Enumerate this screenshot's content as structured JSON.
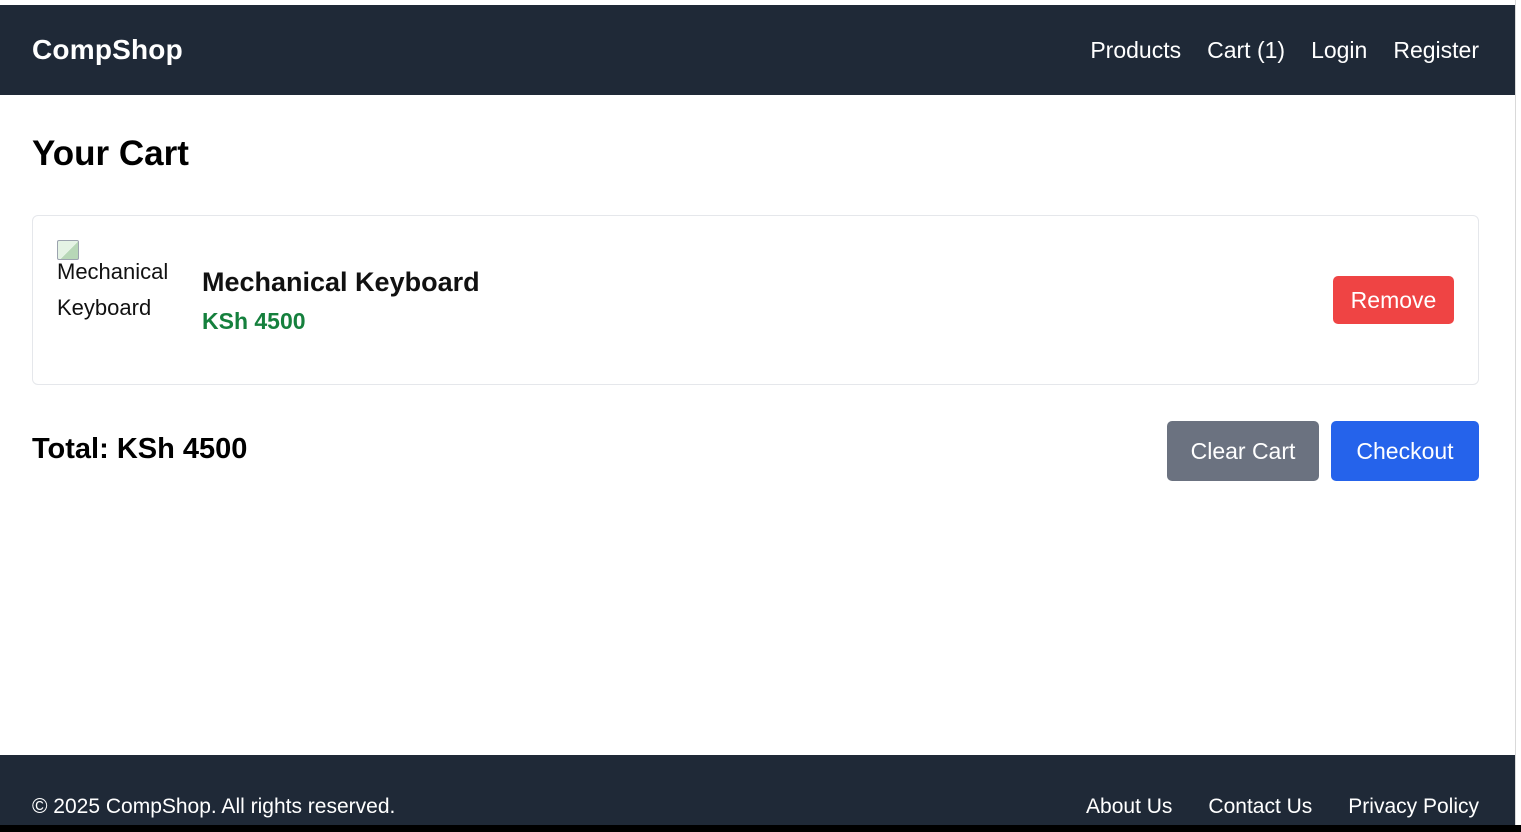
{
  "navbar": {
    "brand": "CompShop",
    "links": [
      "Products",
      "Cart (1)",
      "Login",
      "Register"
    ]
  },
  "page": {
    "title": "Your Cart"
  },
  "cart": {
    "items": [
      {
        "image_alt": "Mechanical Keyboard",
        "name": "Mechanical Keyboard",
        "price": "KSh 4500",
        "remove_label": "Remove"
      }
    ],
    "total": "Total: KSh 4500",
    "clear_label": "Clear Cart",
    "checkout_label": "Checkout"
  },
  "footer": {
    "copyright": "© 2025 CompShop. All rights reserved.",
    "links": [
      "About Us",
      "Contact Us",
      "Privacy Policy"
    ]
  },
  "colors": {
    "nav_bg": "#1f2937",
    "price": "#15803d",
    "remove": "#ef4444",
    "clear": "#6b7280",
    "checkout": "#2563eb"
  }
}
